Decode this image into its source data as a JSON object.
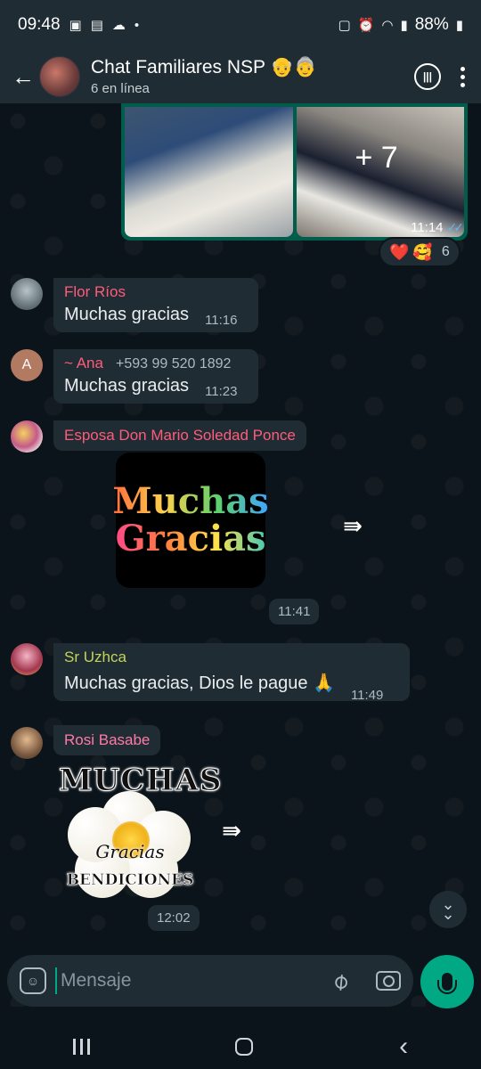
{
  "status_bar": {
    "time": "09:48",
    "battery": "88%"
  },
  "header": {
    "title": "Chat Familiares NSP 👴👵",
    "subtitle": "6 en línea"
  },
  "chat": {
    "media": {
      "more_count": "+ 7",
      "time": "11:14",
      "reactions": [
        "❤️",
        "🥰"
      ],
      "reaction_count": "6"
    },
    "messages": [
      {
        "sender": "Flor Ríos",
        "sender_color": "#ff5c7a",
        "text": "Muchas gracias",
        "time": "11:16"
      },
      {
        "sender": "~ Ana",
        "sender_color": "#ff5c7a",
        "phone": "+593 99 520 1892",
        "avatar_letter": "A",
        "text": "Muchas gracias",
        "time": "11:23"
      },
      {
        "sender": "Esposa Don Mario Soledad Ponce",
        "sender_color": "#ff5c7a",
        "sticker": [
          "Muchas",
          "Gracias"
        ],
        "time": "11:41"
      },
      {
        "sender": "Sr Uzhca",
        "sender_color": "#c4d45a",
        "text": "Muchas gracias, Dios le pague 🙏",
        "time": "11:49"
      },
      {
        "sender": "Rosi Basabe",
        "sender_color": "#ff7aa8",
        "sticker": [
          "MUCHAS",
          "Gracias",
          "BENDICIONES"
        ],
        "time": "12:02"
      }
    ]
  },
  "composer": {
    "placeholder": "Mensaje"
  },
  "colors": {
    "accent": "#00a884",
    "header_bg": "#1f2c34",
    "bubble_in": "#202c33",
    "bubble_out": "#005c4b",
    "chat_bg": "#0b141a"
  },
  "icons": [
    "back-arrow-icon",
    "voice-call-icon",
    "more-options-icon",
    "forward-icon",
    "double-check-icon",
    "scroll-down-icon",
    "sticker-icon",
    "attach-icon",
    "camera-icon",
    "mic-icon"
  ]
}
